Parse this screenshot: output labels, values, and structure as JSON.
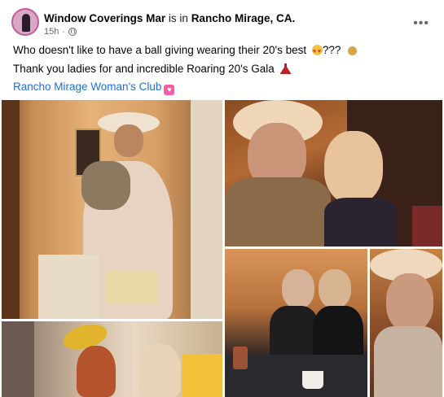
{
  "post": {
    "author": "Window Coverings Mar",
    "is_in": "is in",
    "location": "Rancho Mirage, CA.",
    "time": "15h",
    "line1": "Who doesn't like to have a ball giving wearing their 20's best",
    "line1_suffix": "???",
    "line2": "Thank you ladies for and incredible Roaring 20's Gala",
    "tag": "Rancho Mirage Woman's Club"
  },
  "icons": {
    "privacy": "globe-icon",
    "menu": "more-horizontal-icon",
    "emoji1": "heart-eyes-emoji",
    "emoji2": "moneybag-emoji",
    "emoji3": "dress-emoji",
    "tag_badge": "heart-badge-icon"
  },
  "colors": {
    "link": "#216fdb",
    "muted": "#65676b",
    "badge": "#f35ea6"
  },
  "photos": [
    {
      "subject": "woman in cloche hat taking mirror selfie"
    },
    {
      "subject": "two women smiling selfie in ballroom"
    },
    {
      "subject": "two women seated at banquet table"
    },
    {
      "subject": "woman in cream hat and pearls"
    },
    {
      "subject": "two women with feathered headbands"
    }
  ]
}
